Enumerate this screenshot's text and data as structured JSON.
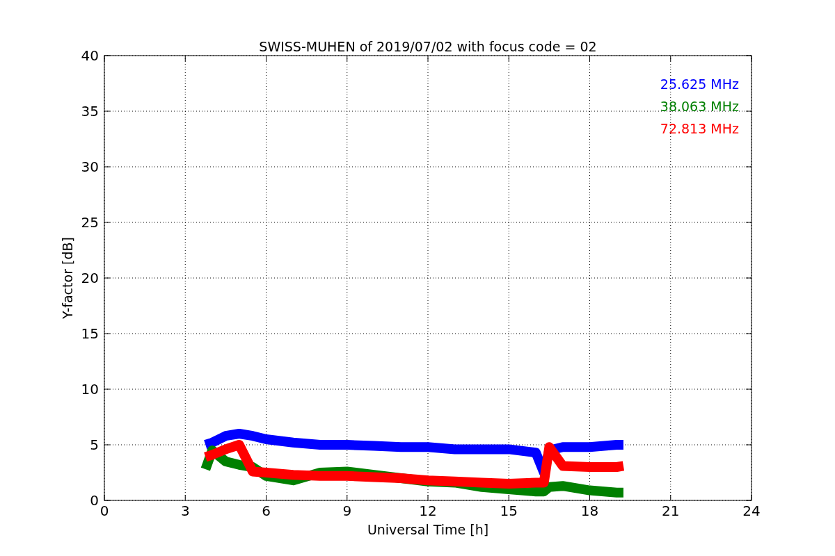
{
  "chart_data": {
    "type": "line",
    "title": "SWISS-MUHEN of 2019/07/02 with focus code = 02",
    "xlabel": "Universal Time [h]",
    "ylabel": "Y-factor [dB]",
    "x": [
      3.75,
      4,
      4.5,
      5,
      5.5,
      6,
      7,
      8,
      9,
      10,
      11,
      12,
      13,
      14,
      15,
      16,
      16.3,
      16.5,
      17,
      18,
      19,
      19.25
    ],
    "series": [
      {
        "name": "25.625 MHz",
        "color": "#0000ff",
        "values": [
          5,
          5.2,
          5.8,
          6,
          5.8,
          5.5,
          5.2,
          5,
          5,
          4.9,
          4.8,
          4.8,
          4.6,
          4.6,
          4.6,
          4.3,
          2.5,
          4.5,
          4.8,
          4.8,
          5,
          5
        ]
      },
      {
        "name": "38.063 MHz",
        "color": "#008000",
        "values": [
          2.8,
          4.5,
          3.5,
          3.2,
          3,
          2.2,
          1.8,
          2.5,
          2.6,
          2.3,
          2,
          1.7,
          1.6,
          1.2,
          1,
          0.8,
          0.8,
          1.2,
          1.3,
          0.9,
          0.7,
          0.7
        ]
      },
      {
        "name": "72.813 MHz",
        "color": "#ff0000",
        "values": [
          3.9,
          4.1,
          4.6,
          5,
          2.6,
          2.5,
          2.3,
          2.2,
          2.2,
          2.1,
          2,
          1.8,
          1.7,
          1.6,
          1.5,
          1.6,
          1.6,
          4.8,
          3.1,
          3,
          3,
          3.1
        ]
      }
    ],
    "grid": true,
    "xlim": [
      0,
      24
    ],
    "ylim": [
      0,
      40
    ],
    "xticks": [
      0,
      3,
      6,
      9,
      12,
      15,
      18,
      21,
      24
    ],
    "yticks": [
      0,
      5,
      10,
      15,
      20,
      25,
      30,
      35,
      40
    ]
  }
}
